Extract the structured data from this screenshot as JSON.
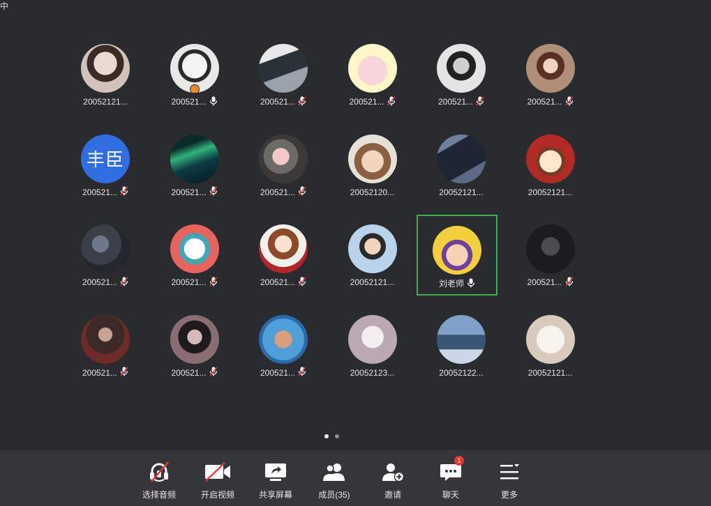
{
  "top_label": "中",
  "participants": [
    {
      "name": "20052121...",
      "mic": "none",
      "bg": "radial-gradient(circle at 50% 40%, #e9d9cf 0 30%, #3b2b27 31% 48%, #cfc3bb 49%)"
    },
    {
      "name": "200521...",
      "mic": "on",
      "bg": "radial-gradient(circle at 50% 45%, #f4f4f4 0 34%, #2a2a2a 35% 45%, #e8e8e8 46%)",
      "host": true
    },
    {
      "name": "200521...",
      "mic": "muted",
      "bg": "linear-gradient(160deg, #e8e8e8 0 30%, #2b3138 31% 60%, #9aa3ab 61%)"
    },
    {
      "name": "200521...",
      "mic": "muted",
      "bg": "radial-gradient(circle at 50% 55%, #f8d5da 0 40%, #fdf6c9 41%)"
    },
    {
      "name": "200521...",
      "mic": "muted",
      "bg": "radial-gradient(circle at 50% 45%, #cfcfcf 0 22%, #222 23% 40%, #e4e4e4 41%)"
    },
    {
      "name": "200521...",
      "mic": "muted",
      "bg": "radial-gradient(circle at 50% 45%, #f0d2c2 0 20%, #5a2f26 21% 38%, #b08e7a 39%)"
    },
    {
      "name": "200521...",
      "mic": "muted",
      "bg": "#2f6de1",
      "text": "丰臣"
    },
    {
      "name": "200521...",
      "mic": "muted",
      "bg": "linear-gradient(160deg, #0b2b2a 0 25%, #2fb27a 40%, #0e3b45 60%, #05161c)"
    },
    {
      "name": "200521...",
      "mic": "muted",
      "bg": "radial-gradient(circle at 45% 45%, #f1c9c9 0 22%, #6c6a66 23% 45%, #3b3a37 46%)"
    },
    {
      "name": "20052120...",
      "mic": "none",
      "bg": "radial-gradient(circle at 50% 55%, #f2d5bf 0 30%, #8a6040 31% 50%, #e6e0d6 51%)"
    },
    {
      "name": "20052121...",
      "mic": "none",
      "bg": "linear-gradient(150deg, #6d7f9a 0 25%, #1e2636 26% 70%, #5a6a85 71%)"
    },
    {
      "name": "20052121...",
      "mic": "none",
      "bg": "radial-gradient(circle at 50% 55%, #ffe7cc 0 30%, #7a3a2a 31% 40%, #b12a24 41%)"
    },
    {
      "name": "200521...",
      "mic": "muted",
      "bg": "radial-gradient(circle at 40% 40%, #6e7888 0 20%, #3a3f4a 21% 50%, #23262c 51%)"
    },
    {
      "name": "200521...",
      "mic": "muted",
      "bg": "radial-gradient(circle at 50% 50%, #ffffff 0 30%, #3fa7b3 31% 45%, #e8635d 46%)"
    },
    {
      "name": "200521...",
      "mic": "muted",
      "bg": "radial-gradient(circle at 50% 40%, #f8e2cf 0 22%, #8b4a2a 23% 40%, #f4f0ea 41% 60%, #b2232a 61%)"
    },
    {
      "name": "20052121...",
      "mic": "none",
      "bg": "radial-gradient(circle at 50% 45%, #f1d3bd 0 22%, #2a2a2a 23% 36%, #b9d3ec 37%)"
    },
    {
      "name": "刘老师",
      "mic": "on",
      "bg": "radial-gradient(circle at 50% 60%, #f7d3b3 0 28%, #6f3fa0 29% 40%, #f4cf3c 41%)",
      "active": true
    },
    {
      "name": "200521...",
      "mic": "muted",
      "bg": "radial-gradient(circle at 50% 45%, #4b4b52 0 25%, #1c1c20 26%)"
    },
    {
      "name": "200521...",
      "mic": "muted",
      "bg": "radial-gradient(circle at 50% 40%, #c7a490 0 18%, #3b2a26 19% 50%, #6f2a2a 51%)"
    },
    {
      "name": "200521...",
      "mic": "muted",
      "bg": "radial-gradient(circle at 50% 45%, #d7b9b9 0 20%, #1f1a1c 21% 45%, #8a6c73 46%)"
    },
    {
      "name": "200521...",
      "mic": "muted",
      "bg": "radial-gradient(circle at 50% 50%, #d9a07b 0 25%, #4fa0d8 26% 60%, #2b6aa6 61%)"
    },
    {
      "name": "20052123...",
      "mic": "none",
      "bg": "radial-gradient(circle at 50% 45%, #f4eef0 0 30%, #bba9b2 31%)"
    },
    {
      "name": "20052122...",
      "mic": "none",
      "bg": "linear-gradient(180deg, #7fa0c9 0 40%, #3a5676 41% 70%, #c9d7e6 71%)"
    },
    {
      "name": "20052121...",
      "mic": "none",
      "bg": "radial-gradient(circle at 50% 50%, #f7f2ec 0 40%, #d8cbbd 41%)"
    }
  ],
  "pager": {
    "count": 2,
    "active": 0
  },
  "toolbar": {
    "audio": "选择音频",
    "video": "开启视频",
    "share": "共享屏幕",
    "members": "成员(35)",
    "invite": "邀请",
    "chat": "聊天",
    "chat_badge": "1",
    "more": "更多"
  },
  "colors": {
    "background": "#292b2e",
    "toolbar": "#353639",
    "active_border": "#3db04f",
    "muted_slash": "#e53935",
    "badge": "#e53935"
  }
}
